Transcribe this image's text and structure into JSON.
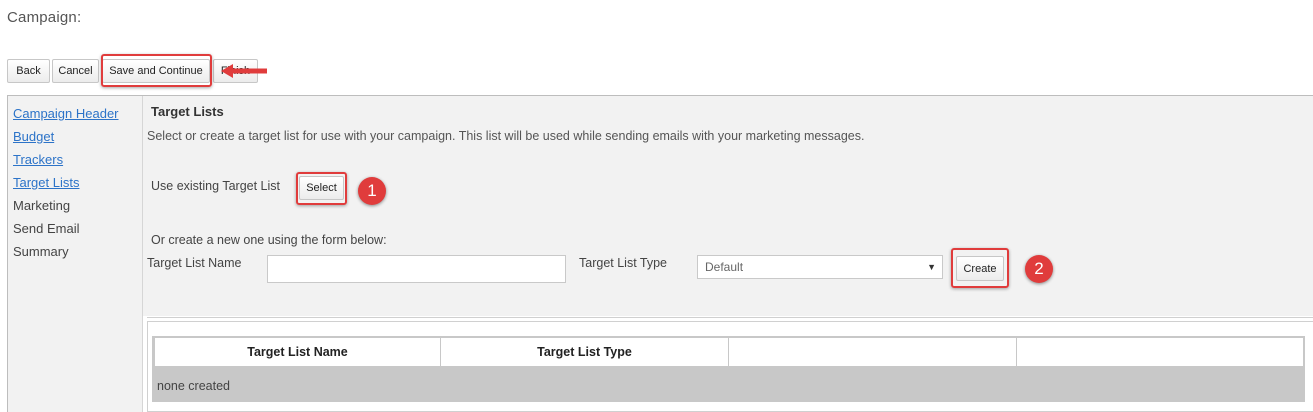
{
  "page_title": "Campaign:",
  "toolbar": {
    "back_label": "Back",
    "cancel_label": "Cancel",
    "save_continue_label": "Save and Continue",
    "finish_label": "Finish"
  },
  "sidebar": {
    "items": [
      {
        "label": "Campaign Header"
      },
      {
        "label": "Budget"
      },
      {
        "label": "Trackers"
      },
      {
        "label": "Target Lists"
      },
      {
        "label": "Marketing"
      },
      {
        "label": "Send Email"
      },
      {
        "label": "Summary"
      }
    ]
  },
  "section": {
    "title": "Target Lists",
    "description": "Select or create a target list for use with your campaign. This list will be used while sending emails with your marketing messages.",
    "use_existing_label": "Use existing Target List",
    "select_button": "Select",
    "create_new_label": "Or create a new one using the form below:",
    "name_label": "Target List Name",
    "name_value": "",
    "type_label": "Target List Type",
    "type_selected": "Default",
    "create_button": "Create"
  },
  "annotations": {
    "badge_1": "1",
    "badge_2": "2",
    "highlight_color": "#e03c3c"
  },
  "table": {
    "columns": [
      "Target List Name",
      "Target List Type",
      "",
      ""
    ],
    "empty_text": "none created"
  },
  "colors": {
    "link": "#2c73c8",
    "panel_bg": "#f2f2f2",
    "table_bg": "#c8c8c8"
  }
}
